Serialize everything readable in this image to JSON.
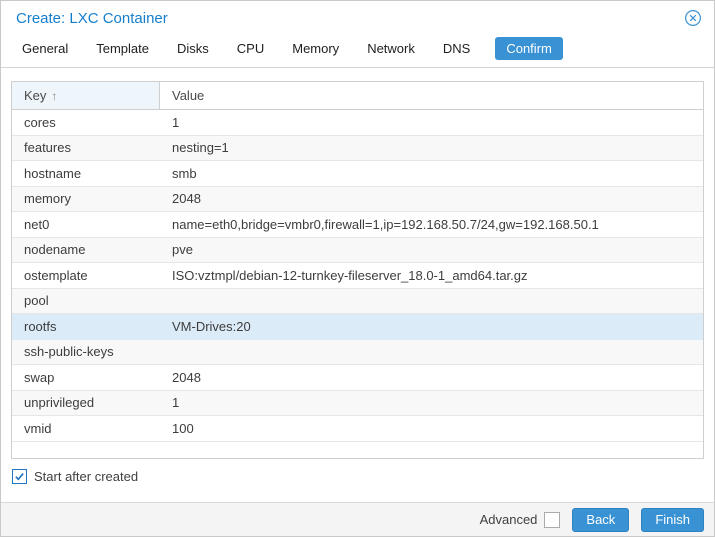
{
  "window": {
    "title": "Create: LXC Container"
  },
  "tabs": [
    {
      "label": "General",
      "active": false
    },
    {
      "label": "Template",
      "active": false
    },
    {
      "label": "Disks",
      "active": false
    },
    {
      "label": "CPU",
      "active": false
    },
    {
      "label": "Memory",
      "active": false
    },
    {
      "label": "Network",
      "active": false
    },
    {
      "label": "DNS",
      "active": false
    },
    {
      "label": "Confirm",
      "active": true
    }
  ],
  "grid": {
    "key_header": "Key",
    "sort_icon": "↑",
    "value_header": "Value",
    "rows": [
      {
        "key": "cores",
        "value": "1",
        "selected": false
      },
      {
        "key": "features",
        "value": "nesting=1",
        "selected": false
      },
      {
        "key": "hostname",
        "value": "smb",
        "selected": false
      },
      {
        "key": "memory",
        "value": "2048",
        "selected": false
      },
      {
        "key": "net0",
        "value": "name=eth0,bridge=vmbr0,firewall=1,ip=192.168.50.7/24,gw=192.168.50.1",
        "selected": false
      },
      {
        "key": "nodename",
        "value": "pve",
        "selected": false
      },
      {
        "key": "ostemplate",
        "value": "ISO:vztmpl/debian-12-turnkey-fileserver_18.0-1_amd64.tar.gz",
        "selected": false
      },
      {
        "key": "pool",
        "value": "",
        "selected": false
      },
      {
        "key": "rootfs",
        "value": "VM-Drives:20",
        "selected": true
      },
      {
        "key": "ssh-public-keys",
        "value": "",
        "selected": false
      },
      {
        "key": "swap",
        "value": "2048",
        "selected": false
      },
      {
        "key": "unprivileged",
        "value": "1",
        "selected": false
      },
      {
        "key": "vmid",
        "value": "100",
        "selected": false
      }
    ]
  },
  "options": {
    "start_after_created_label": "Start after created",
    "start_after_created_checked": true
  },
  "footer": {
    "advanced_label": "Advanced",
    "advanced_checked": false,
    "back_label": "Back",
    "finish_label": "Finish"
  },
  "colors": {
    "accent": "#3892d4",
    "title_text": "#157fcc",
    "selected_row": "#dcebf8",
    "stripe_row": "#f8f8f8",
    "checkbox_blue": "#2275c2"
  }
}
